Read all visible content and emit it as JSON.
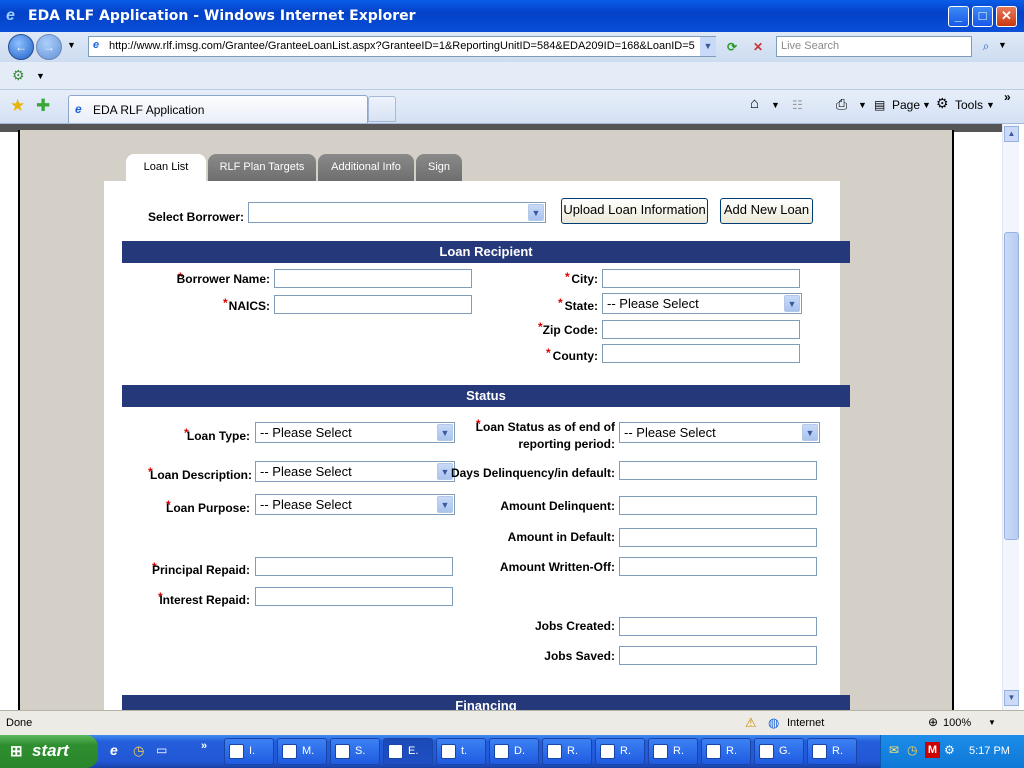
{
  "window": {
    "title": "EDA RLF Application - Windows Internet Explorer"
  },
  "address": {
    "url": "http://www.rlf.imsg.com/Grantee/GranteeLoanList.aspx?GranteeID=1&ReportingUnitID=584&EDA209ID=168&LoanID=5",
    "search_placeholder": "Live Search"
  },
  "browser_tab": {
    "label": "EDA RLF Application"
  },
  "command_bar": {
    "page": "Page",
    "tools": "Tools"
  },
  "tabs": [
    "Loan List",
    "RLF Plan Targets",
    "Additional Info",
    "Sign"
  ],
  "borrower": {
    "label": "Select Borrower:",
    "upload_button": "Upload Loan Information",
    "add_button": "Add New Loan"
  },
  "recipient": {
    "title": "Loan Recipient",
    "borrower_name": "Borrower Name:",
    "naics": "NAICS:",
    "city": "City:",
    "state": "State:",
    "state_value": "-- Please Select",
    "zip": "Zip Code:",
    "county": "County:"
  },
  "status": {
    "title": "Status",
    "loan_type": "Loan Type:",
    "loan_description": "Loan Description:",
    "loan_purpose": "Loan Purpose:",
    "principal_repaid": "Principal Repaid:",
    "interest_repaid": "Interest Repaid:",
    "loan_status_line1": "Loan Status as of end of",
    "loan_status_line2": "reporting period:",
    "days_delinquency": "Days Delinquency/in default:",
    "amount_delinquent": "Amount Delinquent:",
    "amount_default": "Amount in Default:",
    "amount_written_off": "Amount Written-Off:",
    "jobs_created": "Jobs Created:",
    "jobs_saved": "Jobs Saved:",
    "placeholder": "-- Please Select"
  },
  "financing": {
    "title": "Financing"
  },
  "required_mark": "*",
  "statusbar": {
    "left": "Done",
    "zone": "Internet",
    "zoom": "100%"
  },
  "taskbar": {
    "start": "start",
    "tasks": [
      "I.",
      "M.",
      "S.",
      "E.",
      "t.",
      "D.",
      "R.",
      "R.",
      "R.",
      "R.",
      "G.",
      "R."
    ],
    "clock": "5:17 PM"
  },
  "colors": {
    "section_header": "#25387a",
    "required": "#dd0000"
  }
}
